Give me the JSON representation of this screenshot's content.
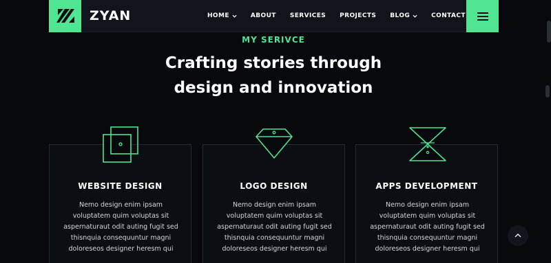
{
  "header": {
    "brand": "ZYAN",
    "nav": [
      {
        "label": "HOME",
        "has_dropdown": true
      },
      {
        "label": "ABOUT",
        "has_dropdown": false
      },
      {
        "label": "SERVICES",
        "has_dropdown": false
      },
      {
        "label": "PROJECTS",
        "has_dropdown": false
      },
      {
        "label": "BLOG",
        "has_dropdown": true
      },
      {
        "label": "CONTACT",
        "has_dropdown": false
      }
    ],
    "menu_icon": "hamburger-icon",
    "logo_icon": "brand-slashes-icon"
  },
  "section": {
    "eyebrow": "MY SERIVCE",
    "headline_line1": "Crafting stories through",
    "headline_line2": "design and innovation"
  },
  "cards": [
    {
      "title": "WEBSITE DESIGN",
      "icon": "layered-squares-icon",
      "lines": [
        "Nemo design enim ipsam",
        "voluptatem quim voluptas sit",
        "aspernaturaut odit auting fugit sed",
        "thisnquia consequuntur magni",
        "doloreseos designer heresm qui"
      ]
    },
    {
      "title": "LOGO DESIGN",
      "icon": "diamond-icon",
      "lines": [
        "Nemo design enim ipsam",
        "voluptatem quim voluptas sit",
        "aspernaturaut odit auting fugit sed",
        "thisnquia consequuntur magni",
        "doloreseos designer heresm qui"
      ]
    },
    {
      "title": "APPS DEVELOPMENT",
      "icon": "hourglass-icon",
      "lines": [
        "Nemo design enim ipsam",
        "voluptatem quim voluptas sit",
        "aspernaturaut odit auting fugit sed",
        "thisnquia consequuntur magni",
        "doloreseos designer heresm qui"
      ]
    }
  ],
  "colors": {
    "accent": "#4fe591",
    "background": "#07090d",
    "card_border": "#262a33"
  },
  "scroll_top_icon": "chevron-up-icon"
}
